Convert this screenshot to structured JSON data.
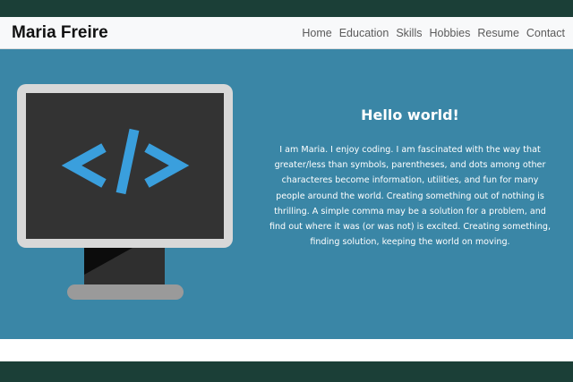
{
  "navbar": {
    "brand": "Maria Freire",
    "links": [
      "Home",
      "Education",
      "Skills",
      "Hobbies",
      "Resume",
      "Contact"
    ]
  },
  "hero": {
    "title": "Hello world!",
    "body": "I am Maria. I enjoy coding. I am fascinated with the way that greater/less than symbols, parentheses, and dots among other characteres become information, utilities, and fun for many people around the world. Creating something out of nothing is thrilling. A simple comma may be a solution for a problem, and find out where it was (or was not) is excited. Creating something, finding solution, keeping the world on moving.",
    "illustration": {
      "icon": "monitor-code-icon",
      "code_glyph": "</>"
    }
  },
  "colors": {
    "navbar_bg": "#f8f9fa",
    "hero_bg": "#3a86a6",
    "page_bg": "#1b3f37",
    "code_blue": "#3a9fdd"
  }
}
